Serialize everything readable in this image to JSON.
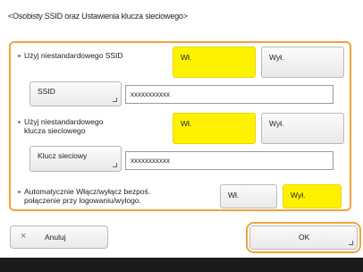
{
  "title": "<Osobisty SSID oraz Ustawienia klucza sieciowego>",
  "ssid_section": {
    "label": "Użyj niestandardowego SSID",
    "on_label": "Wł.",
    "off_label": "Wył.",
    "selected": "on",
    "field_button_label": "SSID",
    "field_value": "xxxxxxxxxxx"
  },
  "key_section": {
    "label_line1": "Użyj niestandardowego",
    "label_line2": "klucza sieciowego",
    "on_label": "Wł.",
    "off_label": "Wył.",
    "selected": "on",
    "field_button_label": "Klucz sieciowy",
    "field_value": "xxxxxxxxxxx"
  },
  "auto_section": {
    "label_line1": "Automatycznie Włącz/wyłącz bezpoś.",
    "label_line2": "połączenie przy logowaniu/wylogo.",
    "on_label": "Wł.",
    "off_label": "Wył.",
    "selected": "off"
  },
  "footer": {
    "cancel_label": "Anuluj",
    "ok_label": "OK"
  },
  "colors": {
    "accent_orange": "#f0a43a",
    "selected_yellow": "#fff200",
    "bullet_blue": "#4a90c8"
  }
}
